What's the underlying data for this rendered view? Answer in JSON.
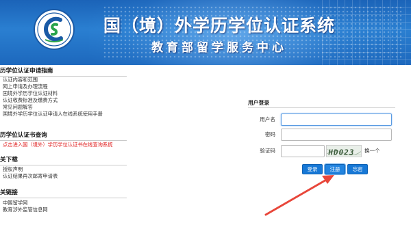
{
  "header": {
    "title": "国（境）外学历学位认证系统",
    "subtitle": "教育部留学服务中心",
    "logo": "csc-logo"
  },
  "sections": [
    {
      "title": "历学位认证申请指南",
      "items": [
        "认证内容和范围",
        "网上申请及办理流程",
        "国境外学历学位认证材料",
        "认证收费标准及缴费方式",
        "常见问题解答",
        "国境外学历学位认证申请人在线系统使用手册"
      ]
    },
    {
      "title": "历学位认证书查询",
      "items": [
        "点击进入国（境外）学历学位认证书在线查询系统"
      ]
    },
    {
      "title": "关下载",
      "items": [
        "授权声明",
        "认证结果再次邮寄申请表"
      ]
    },
    {
      "title": "关链接",
      "items": [
        "中国留学网",
        "教育涉外监管信息网"
      ]
    }
  ],
  "login": {
    "title": "用户登录",
    "username_label": "用户名",
    "username_value": "",
    "password_label": "密码",
    "password_value": "",
    "captcha_label": "验证码",
    "captcha_value": "",
    "captcha_image_text": "HD023",
    "refresh_label": "换一个",
    "login_button": "登录",
    "register_button": "注册",
    "forgot_button": "忘密"
  },
  "colors": {
    "banner": "#1d6bbf",
    "button": "#1778d6",
    "link_highlight": "#e02020",
    "arrow": "#e8463a"
  }
}
